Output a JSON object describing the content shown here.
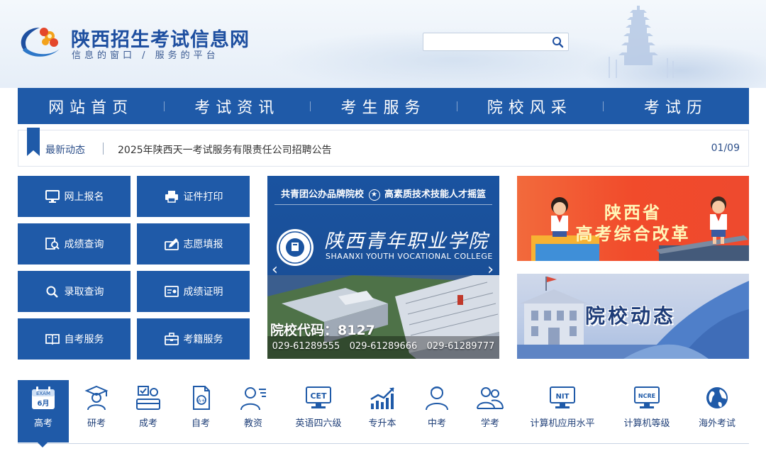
{
  "header": {
    "site_title": "陕西招生考试信息网",
    "slogan": "信息的窗口 / 服务的平台",
    "search": {
      "placeholder": ""
    }
  },
  "nav": {
    "items": [
      {
        "label": "网站首页"
      },
      {
        "label": "考试资讯"
      },
      {
        "label": "考生服务"
      },
      {
        "label": "院校风采"
      },
      {
        "label": "考试历"
      }
    ]
  },
  "ticker": {
    "label": "最新动态",
    "headline": "2025年陕西天一考试服务有限责任公司招聘公告",
    "page": "01/09"
  },
  "services": [
    {
      "label": "网上报名",
      "icon": "monitor-icon"
    },
    {
      "label": "证件打印",
      "icon": "printer-icon"
    },
    {
      "label": "成绩查询",
      "icon": "score-search-icon"
    },
    {
      "label": "志愿填报",
      "icon": "application-form-icon"
    },
    {
      "label": "录取查询",
      "icon": "search-icon"
    },
    {
      "label": "成绩证明",
      "icon": "certificate-icon"
    },
    {
      "label": "自考服务",
      "icon": "open-book-icon"
    },
    {
      "label": "考籍服务",
      "icon": "briefcase-icon"
    }
  ],
  "banner": {
    "headline_left": "共青团公办品牌院校",
    "headline_right": "高素质技术技能人才摇篮",
    "college_name_cn": "陕西青年职业学院",
    "college_name_en": "SHAANXI YOUTH VOCATIONAL COLLEGE",
    "college_code": "院校代码：8127",
    "phones": [
      "029-61289555",
      "029-61289666",
      "029-61289777"
    ]
  },
  "promos": {
    "reform_line1": "陕西省",
    "reform_line2": "高考综合改革",
    "college_news": "院校动态"
  },
  "categories": {
    "active_badge_top": "EXAM",
    "active_badge_bottom": "6月",
    "items": [
      {
        "label": "高考",
        "icon": "calendar-exam-icon"
      },
      {
        "label": "研考",
        "icon": "graduate-icon"
      },
      {
        "label": "成考",
        "icon": "adult-exam-icon"
      },
      {
        "label": "自考",
        "icon": "self-study-doc-icon"
      },
      {
        "label": "教资",
        "icon": "teacher-icon"
      },
      {
        "label": "英语四六级",
        "icon": "cet-icon"
      },
      {
        "label": "专升本",
        "icon": "growth-chart-icon"
      },
      {
        "label": "中考",
        "icon": "student-icon"
      },
      {
        "label": "学考",
        "icon": "students-icon"
      },
      {
        "label": "计算机应用水平",
        "icon": "nit-monitor-icon"
      },
      {
        "label": "计算机等级",
        "icon": "ncre-monitor-icon"
      },
      {
        "label": "海外考试",
        "icon": "globe-icon"
      }
    ],
    "cet_text": "CET",
    "nit_text": "NIT",
    "ncre_text": "NCRE"
  },
  "colors": {
    "primary": "#1f5aa8",
    "title": "#1e4fa0",
    "reform_bg": "#f14b2b"
  }
}
